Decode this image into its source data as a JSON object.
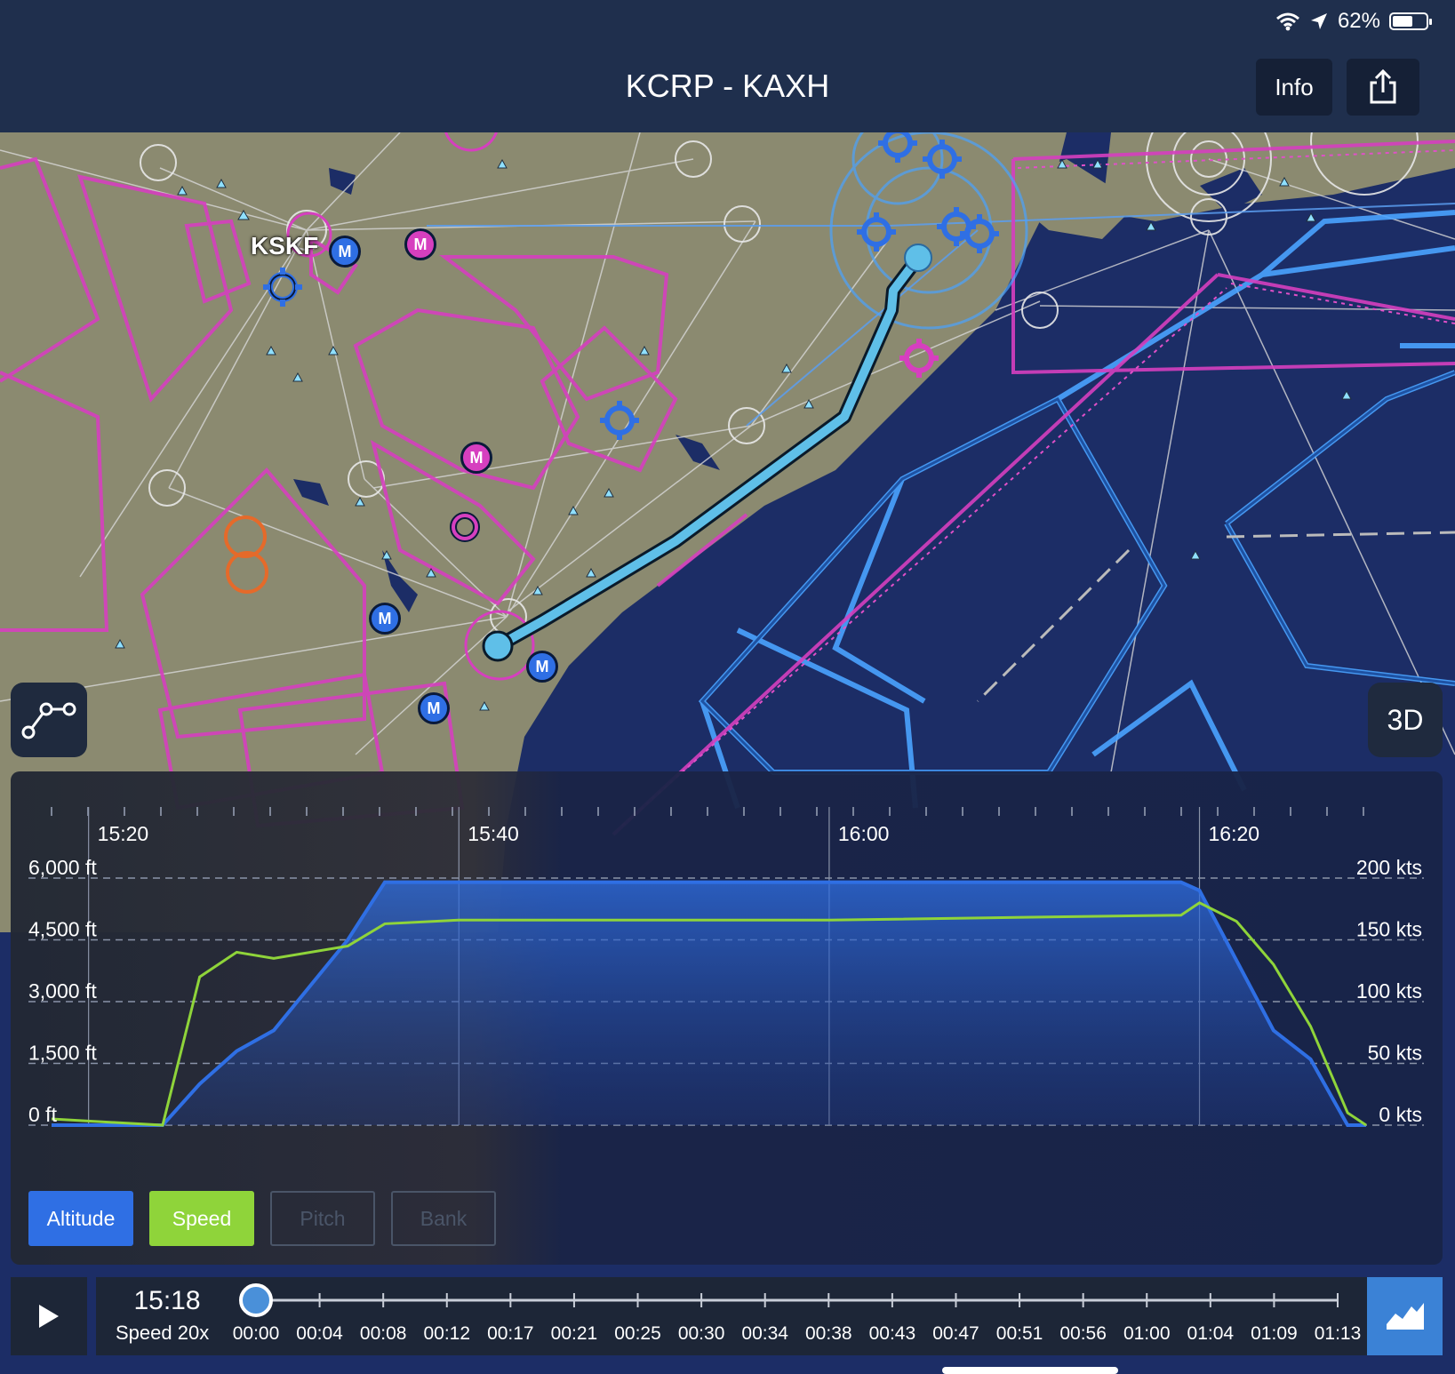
{
  "status_bar": {
    "battery": "62%",
    "battery_level": 0.62
  },
  "nav": {
    "title": "KCRP - KAXH",
    "info_label": "Info",
    "share_icon": "share-icon"
  },
  "map": {
    "airport_label": "KSKF",
    "marker_label": "M",
    "button_3d": "3D",
    "route_button_icon": "route-icon"
  },
  "chart": {
    "time_ticks": [
      "15:20",
      "15:40",
      "16:00",
      "16:20"
    ],
    "altitude_ticks": [
      "6,000 ft",
      "4,500 ft",
      "3,000 ft",
      "1,500 ft",
      "0 ft"
    ],
    "speed_ticks": [
      "200 kts",
      "150 kts",
      "100 kts",
      "50 kts",
      "0 kts"
    ],
    "toggles": [
      {
        "label": "Altitude",
        "active": true,
        "color": "#2f6fe4"
      },
      {
        "label": "Speed",
        "active": true,
        "color": "#8fd43a"
      },
      {
        "label": "Pitch",
        "active": false,
        "color": "#4a5568"
      },
      {
        "label": "Bank",
        "active": false,
        "color": "#4a5568"
      }
    ]
  },
  "chart_data": {
    "type": "area",
    "x": [
      "15:18",
      "15:24",
      "15:26",
      "15:28",
      "15:30",
      "15:34",
      "15:36",
      "15:40",
      "16:00",
      "16:19",
      "16:20",
      "16:22",
      "16:24",
      "16:26",
      "16:28",
      "16:29"
    ],
    "series": [
      {
        "name": "Altitude",
        "unit": "ft",
        "color": "#2f6fe4",
        "values": [
          0,
          0,
          1000,
          1800,
          2300,
          4500,
          5900,
          5900,
          5900,
          5900,
          5700,
          4000,
          2300,
          1600,
          0,
          0
        ]
      },
      {
        "name": "Speed",
        "unit": "kts",
        "color": "#8fd43a",
        "values": [
          5,
          0,
          120,
          140,
          135,
          145,
          163,
          166,
          166,
          170,
          180,
          165,
          130,
          80,
          10,
          0
        ]
      }
    ],
    "ylim_left": [
      0,
      6000
    ],
    "ylim_right": [
      0,
      200
    ],
    "grid": true
  },
  "playback": {
    "current_time": "15:18",
    "speed": "Speed 20x",
    "position": 0,
    "elapsed_ticks": [
      "00:00",
      "00:04",
      "00:08",
      "00:12",
      "00:17",
      "00:21",
      "00:25",
      "00:30",
      "00:34",
      "00:38",
      "00:43",
      "00:47",
      "00:51",
      "00:56",
      "01:00",
      "01:04",
      "01:09",
      "01:13"
    ]
  }
}
